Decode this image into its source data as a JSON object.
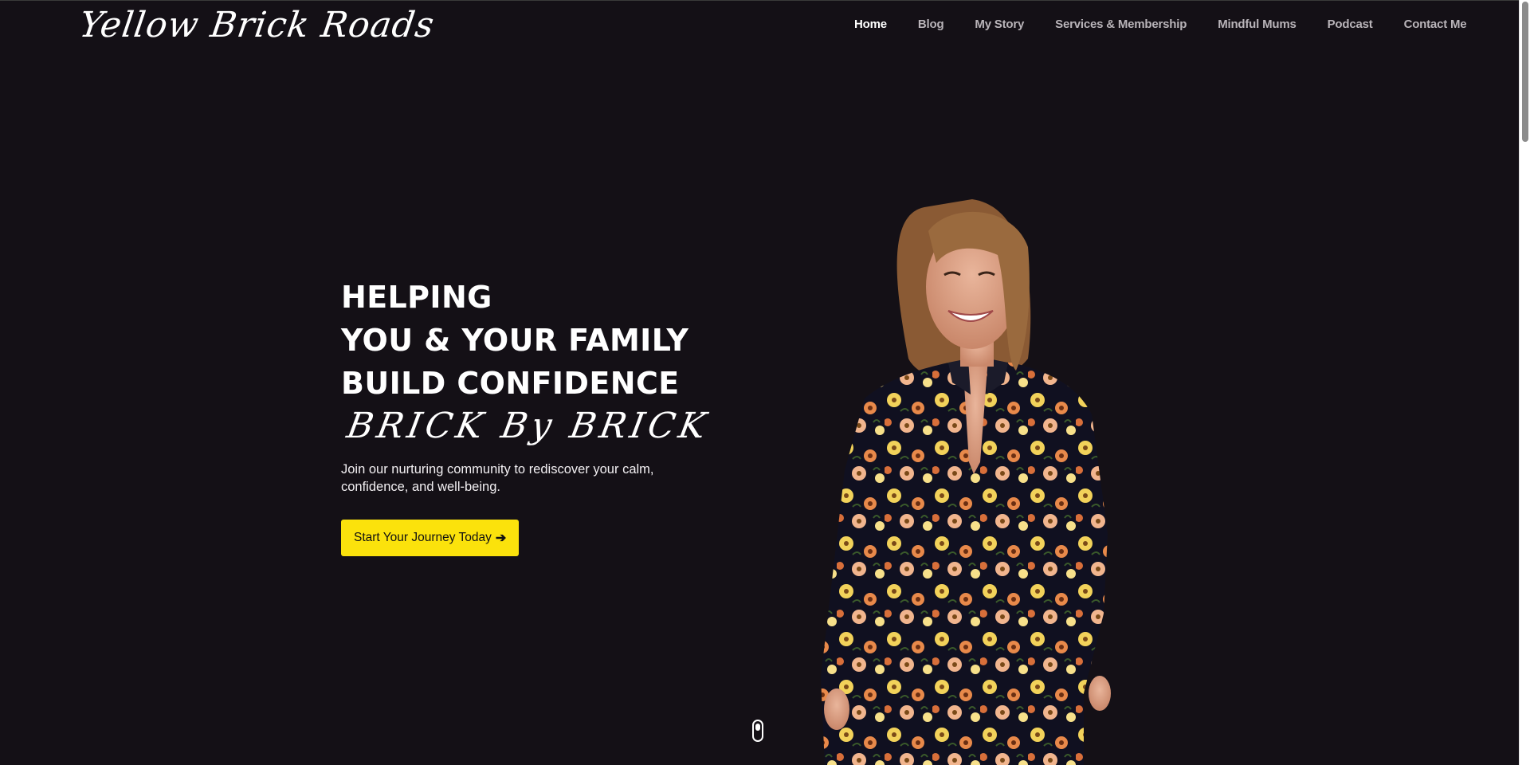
{
  "header": {
    "logo": "Yellow Brick Roads",
    "nav": [
      {
        "label": "Home",
        "active": true
      },
      {
        "label": "Blog"
      },
      {
        "label": "My Story"
      },
      {
        "label": "Services & Membership"
      },
      {
        "label": "Mindful Mums"
      },
      {
        "label": "Podcast"
      },
      {
        "label": "Contact Me"
      }
    ]
  },
  "hero": {
    "line1": "HELPING",
    "line2": "YOU & YOUR FAMILY",
    "line3": "BUILD CONFIDENCE",
    "script": "BRICK By BRICK",
    "description": "Join our nurturing community to rediscover your calm, confidence, and well-being.",
    "cta_label": "Start Your Journey Today",
    "cta_icon": "arrow-right-icon"
  },
  "colors": {
    "background": "#141016",
    "accent": "#fbe20c",
    "text": "#ffffff",
    "nav_inactive": "#b9b4b9"
  },
  "icons": {
    "scroll_indicator": "mouse-scroll-icon"
  }
}
